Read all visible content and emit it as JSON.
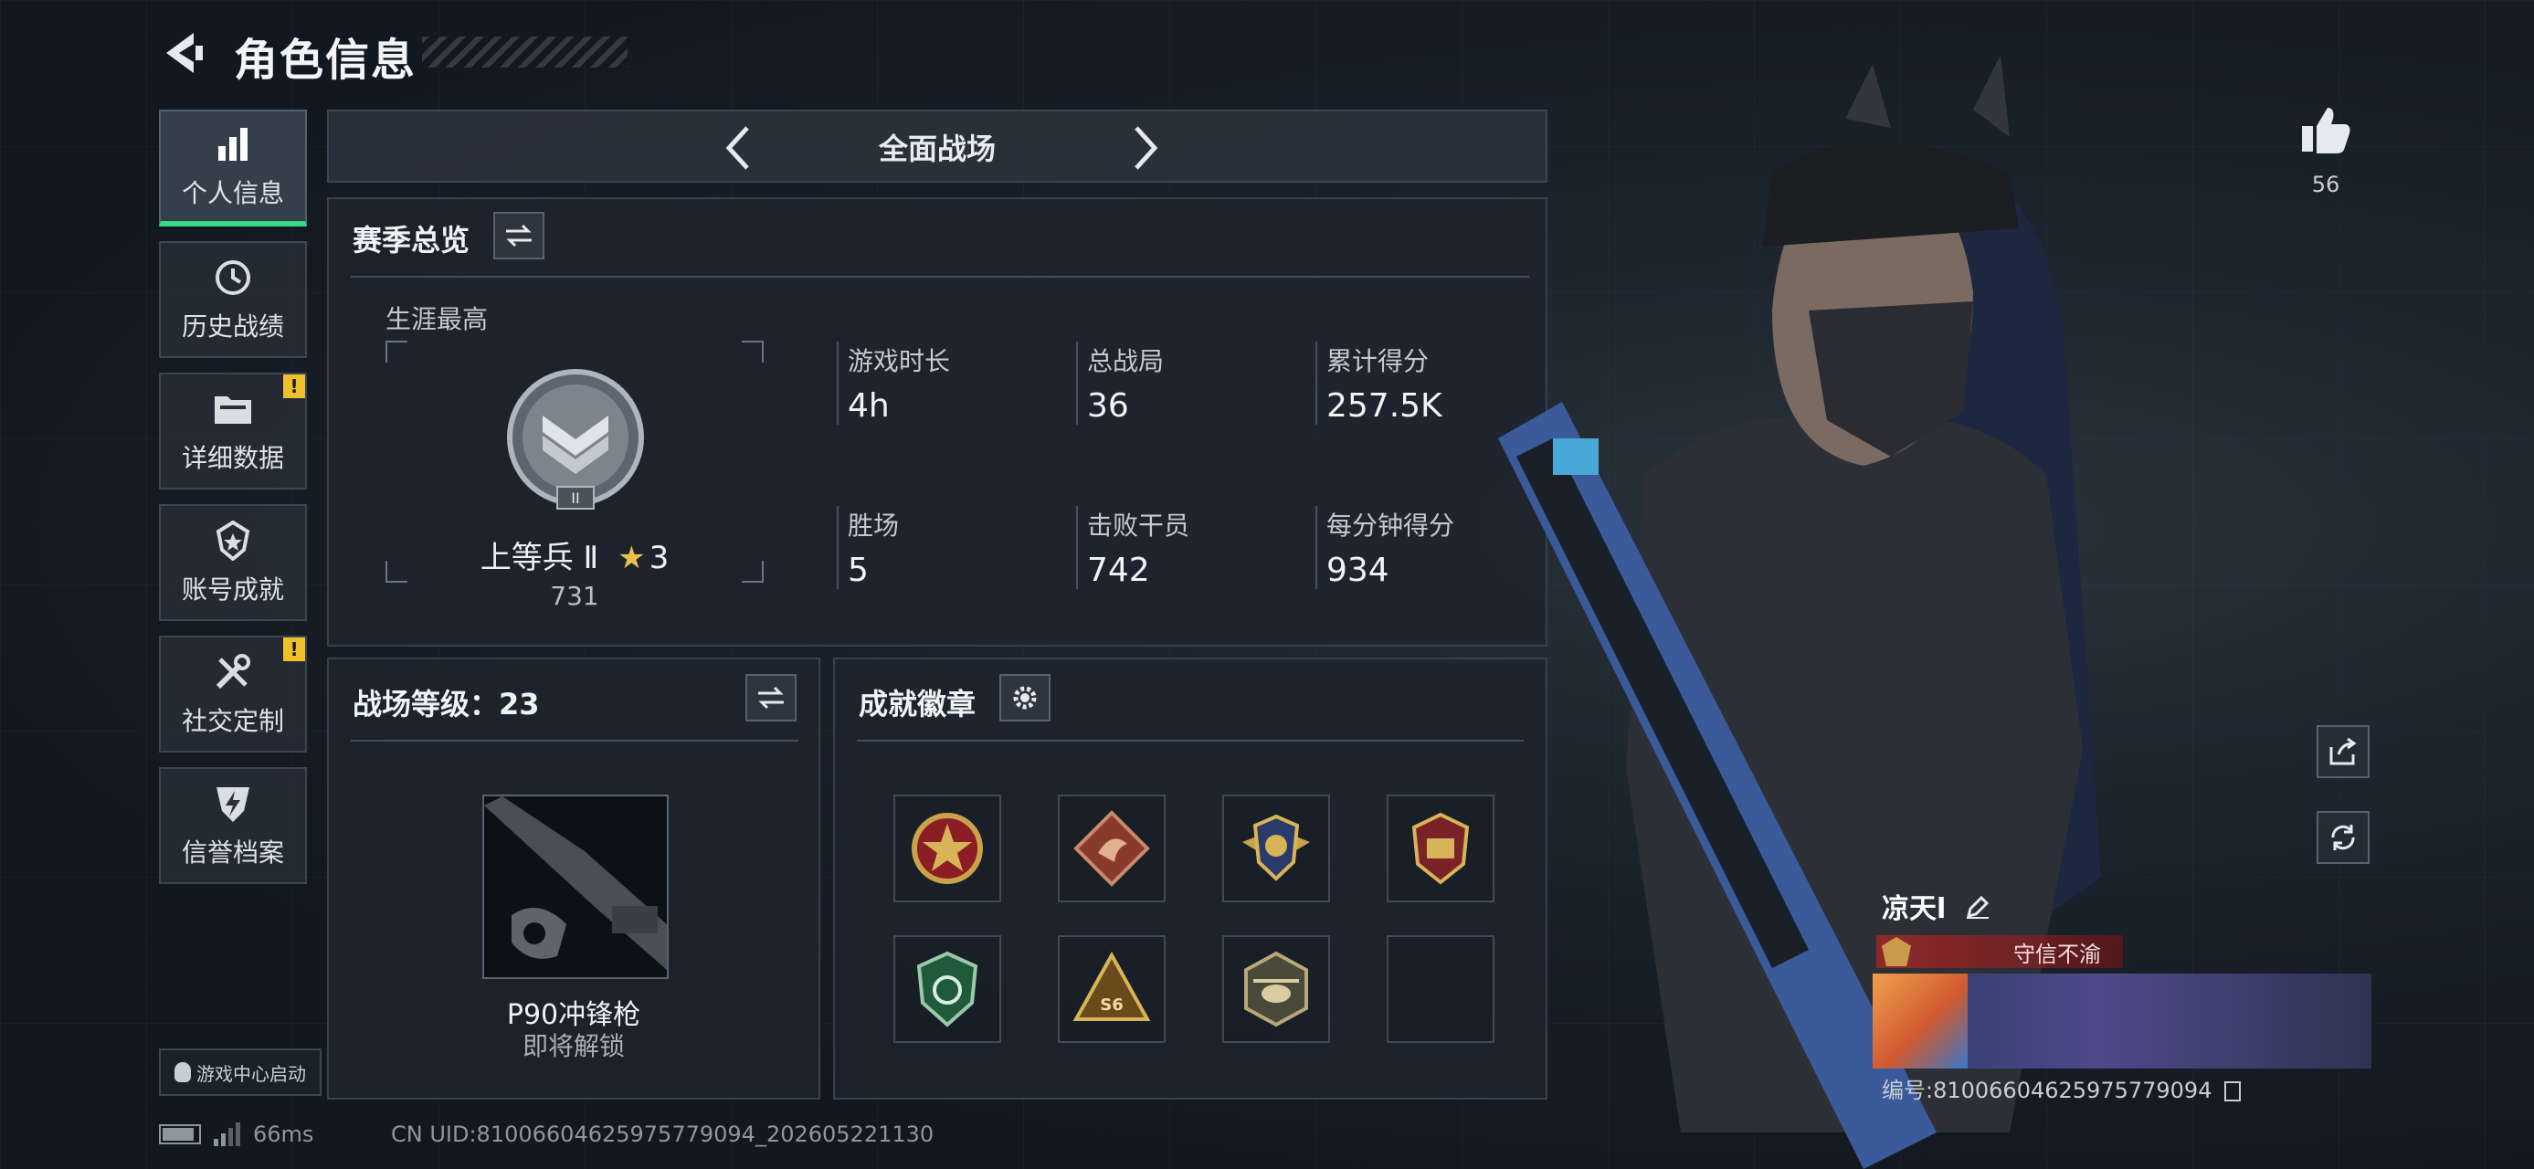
{
  "header": {
    "title": "角色信息"
  },
  "nav": [
    {
      "label": "个人信息",
      "icon": "bar-chart-icon",
      "active": true,
      "alert": false
    },
    {
      "label": "历史战绩",
      "icon": "history-icon",
      "active": false,
      "alert": false
    },
    {
      "label": "详细数据",
      "icon": "folder-icon",
      "active": false,
      "alert": true
    },
    {
      "label": "账号成就",
      "icon": "achievement-icon",
      "active": false,
      "alert": false
    },
    {
      "label": "社交定制",
      "icon": "tools-icon",
      "active": false,
      "alert": true
    },
    {
      "label": "信誉档案",
      "icon": "credit-icon",
      "active": false,
      "alert": false
    }
  ],
  "alert_mark": "!",
  "game_center": {
    "label": "游戏中心启动"
  },
  "mode": {
    "title": "全面战场"
  },
  "season": {
    "title": "赛季总览",
    "rank_label": "生涯最高",
    "rank_name": "上等兵 Ⅱ",
    "rank_stars": "3",
    "rank_score": "731",
    "rank_numeral": "II",
    "stats": [
      {
        "label": "游戏时长",
        "value": "4h"
      },
      {
        "label": "总战局",
        "value": "36"
      },
      {
        "label": "累计得分",
        "value": "257.5K"
      },
      {
        "label": "胜场",
        "value": "5"
      },
      {
        "label": "击败干员",
        "value": "742"
      },
      {
        "label": "每分钟得分",
        "value": "934"
      }
    ]
  },
  "level": {
    "title": "战场等级：23",
    "weapon_name": "P90冲锋枪",
    "weapon_status": "即将解锁"
  },
  "badges": {
    "title": "成就徽章",
    "slots": [
      "star-emblem-badge",
      "dragon-badge",
      "shield-wings-badge",
      "helmet-badge",
      "green-shield-badge",
      "s6-triangle-badge",
      "helicopter-badge",
      "empty"
    ],
    "s6_text": "S6"
  },
  "status": {
    "ping": "66ms",
    "uid": "CN UID:8100660462597577909 4_202605221130"
  },
  "uid_text": "CN UID:81006604625975779094_202605221130",
  "profile": {
    "likes": "56",
    "name": "凉天l",
    "tag": "守信不渝",
    "id_text": "编号:81006604625975779094"
  },
  "colors": {
    "accent": "#39d98a",
    "warning": "#f0c02a",
    "tag_red": "#a02828"
  }
}
